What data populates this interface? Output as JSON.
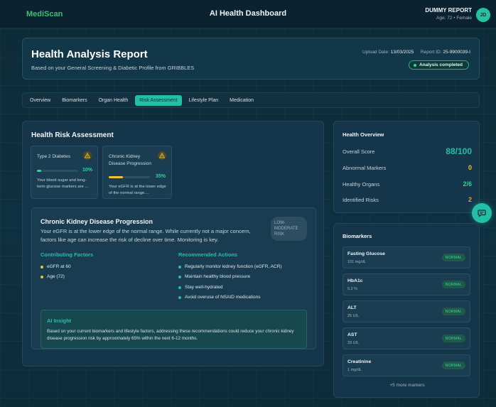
{
  "header": {
    "brand": "MediScan",
    "title": "AI Health Dashboard",
    "user_name": "DUMMY REPORT",
    "user_meta": "Age: 72 • Female",
    "avatar_initials": "JD"
  },
  "report": {
    "title": "Health Analysis Report",
    "subtitle": "Based on your General Screening & Diabetic Profile from GRIBBLES",
    "upload_label": "Upload Date:",
    "upload_date": "13/03/2025",
    "id_label": "Report ID:",
    "report_id": "25-9900039-I",
    "status": "Analysis completed"
  },
  "tabs": [
    "Overview",
    "Biomarkers",
    "Organ Health",
    "Risk Assessment",
    "Lifestyle Plan",
    "Medication"
  ],
  "active_tab": "Risk Assessment",
  "risk": {
    "title": "Health Risk Assessment",
    "cards": [
      {
        "name": "Type 2 Diabetes",
        "percent": "10%",
        "level": 0.1,
        "bar_color": "#2fd39a",
        "desc": "Your blood sugar and long-term glucose markers are ..."
      },
      {
        "name": "Chronic Kidney Disease Progression",
        "percent": "35%",
        "level": 0.35,
        "bar_color": "#f2c12e",
        "desc": "Your eGFR is at the lower edge of the normal range...."
      }
    ],
    "detail": {
      "title": "Chronic Kidney Disease Progression",
      "body": "Your eGFR is at the lower edge of the normal range. While currently not a major concern, factors like age can increase the risk of decline over time. Monitoring is key.",
      "risk_tag": "LOW-MODERATE RISK",
      "factors_heading": "Contributing Factors",
      "factors": [
        "eGFR at 60",
        "Age (72)"
      ],
      "actions_heading": "Recommended Actions",
      "actions": [
        "Regularly monitor kidney function (eGFR, ACR)",
        "Maintain healthy blood pressure",
        "Stay well-hydrated",
        "Avoid overuse of NSAID medications"
      ],
      "insight_title": "AI Insight",
      "insight_body": "Based on your current biomarkers and lifestyle factors, addressing these recommendations could reduce your chronic kidney disease progression risk by approximately 65% within the next 6-12 months."
    }
  },
  "overview": {
    "title": "Health Overview",
    "rows": [
      {
        "label": "Overall Score",
        "value": "88/100",
        "color": "#22bfa6"
      },
      {
        "label": "Abnormal Markers",
        "value": "0",
        "color": "#f2c12e"
      },
      {
        "label": "Healthy Organs",
        "value": "2/6",
        "color": "#2fd39a"
      },
      {
        "label": "Identified Risks",
        "value": "2",
        "color": "#f29a2e"
      }
    ]
  },
  "biomarkers": {
    "title": "Biomarkers",
    "items": [
      {
        "name": "Fasting Glucose",
        "value": "101 mg/dL",
        "status": "NORMAL"
      },
      {
        "name": "HbA1c",
        "value": "5.2 %",
        "status": "NORMAL"
      },
      {
        "name": "ALT",
        "value": "25 U/L",
        "status": "NORMAL"
      },
      {
        "name": "AST",
        "value": "33 U/L",
        "status": "NORMAL"
      },
      {
        "name": "Creatinine",
        "value": "1 mg/dL",
        "status": "NORMAL"
      }
    ],
    "more": "+5 more markers"
  },
  "colors": {
    "accent": "#22bfa6",
    "warning": "#f2c12e",
    "success": "#2fd39a"
  },
  "icons": {
    "warning": "warning-triangle-icon",
    "chat": "chat-bubble-icon",
    "status": "status-dot-icon"
  }
}
